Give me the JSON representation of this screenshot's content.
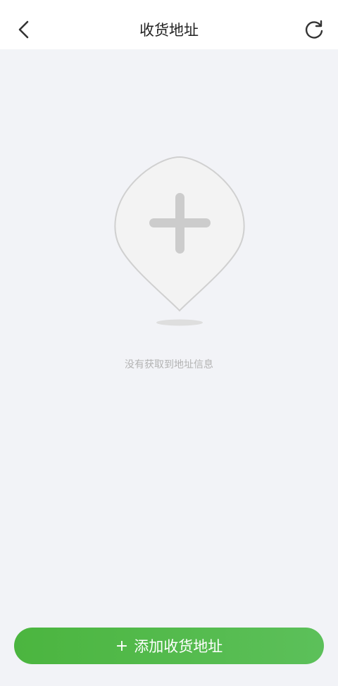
{
  "header": {
    "title": "收货地址",
    "back_icon": "chevron-left-icon",
    "refresh_icon": "refresh-icon"
  },
  "empty_state": {
    "icon": "map-pin-plus-icon",
    "message": "没有获取到地址信息"
  },
  "footer": {
    "add_button_plus": "+",
    "add_button_label": "添加收货地址"
  },
  "colors": {
    "accent": "#52b84a",
    "background": "#f2f3f7"
  }
}
